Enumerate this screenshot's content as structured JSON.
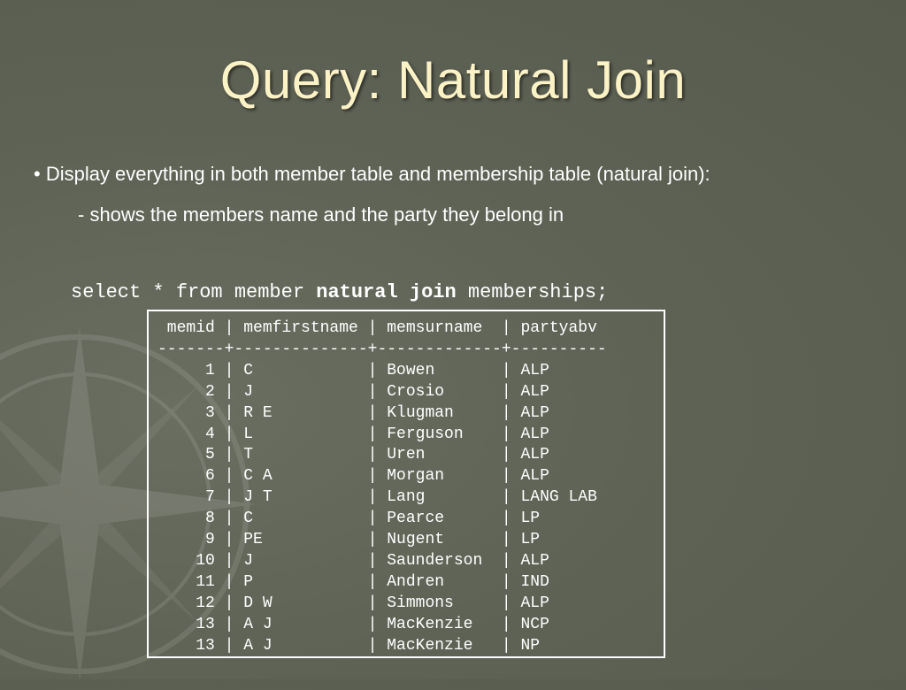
{
  "slide": {
    "title": "Query: Natural Join",
    "bullet_1": "• Display everything in both member table and membership table (natural join):",
    "bullet_2": "- shows the members name and the party they belong in"
  },
  "query": {
    "before": "select * from member ",
    "keyword": "natural join",
    "after": " memberships;"
  },
  "result": {
    "header": " memid | memfirstname | memsurname  | partyabv",
    "separator": "-------+--------------+-------------+----------",
    "rows": [
      "     1 | C            | Bowen       | ALP",
      "     2 | J            | Crosio      | ALP",
      "     3 | R E          | Klugman     | ALP",
      "     4 | L            | Ferguson    | ALP",
      "     5 | T            | Uren        | ALP",
      "     6 | C A          | Morgan      | ALP",
      "     7 | J T          | Lang        | LANG LAB",
      "     8 | C            | Pearce      | LP",
      "     9 | PE           | Nugent      | LP",
      "    10 | J            | Saunderson  | ALP",
      "    11 | P            | Andren      | IND",
      "    12 | D W          | Simmons     | ALP",
      "    13 | A J          | MacKenzie   | NCP",
      "    13 | A J          | MacKenzie   | NP"
    ]
  },
  "colors": {
    "background": "#5f6355",
    "title": "#fbf2c6",
    "text": "#ffffff"
  },
  "icons": {
    "background_watermark": "compass-rose-icon"
  }
}
